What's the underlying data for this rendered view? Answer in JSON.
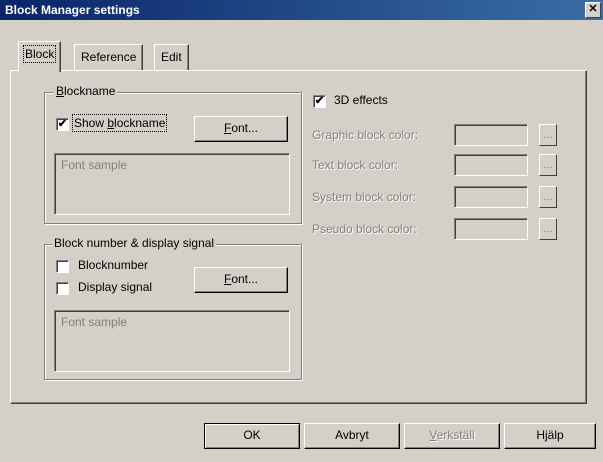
{
  "window": {
    "title": "Block Manager settings",
    "close_glyph": "✕"
  },
  "tabs": [
    {
      "label": "Block"
    },
    {
      "label": "Reference"
    },
    {
      "label": "Edit"
    }
  ],
  "blockname_group": {
    "legend_prefix": "B",
    "legend_rest": "lockname",
    "show_blockname": {
      "label_prefix": "Show ",
      "label_underline": "b",
      "label_rest": "lockname",
      "checked_glyph": "✔"
    },
    "font_button": {
      "underline": "F",
      "rest": "ont..."
    },
    "font_sample": "Font sample"
  },
  "number_group": {
    "legend": "Block number & display signal",
    "blocknumber": {
      "label": "Blocknumber"
    },
    "display_signal": {
      "label": "Display signal"
    },
    "font_button": {
      "underline": "F",
      "rest": "ont..."
    },
    "font_sample": "Font sample"
  },
  "effects": {
    "label": "3D effects",
    "checked_glyph": "✔"
  },
  "colors": [
    {
      "label": "Graphic block color:",
      "button": "..."
    },
    {
      "label": "Text block color:",
      "button": "..."
    },
    {
      "label": "System block color:",
      "button": "..."
    },
    {
      "label": "Pseudo block color:",
      "button": "..."
    }
  ],
  "footer": {
    "ok": "OK",
    "cancel": "Avbryt",
    "apply_underline": "V",
    "apply_rest": "erkställ",
    "help": "Hjälp"
  }
}
